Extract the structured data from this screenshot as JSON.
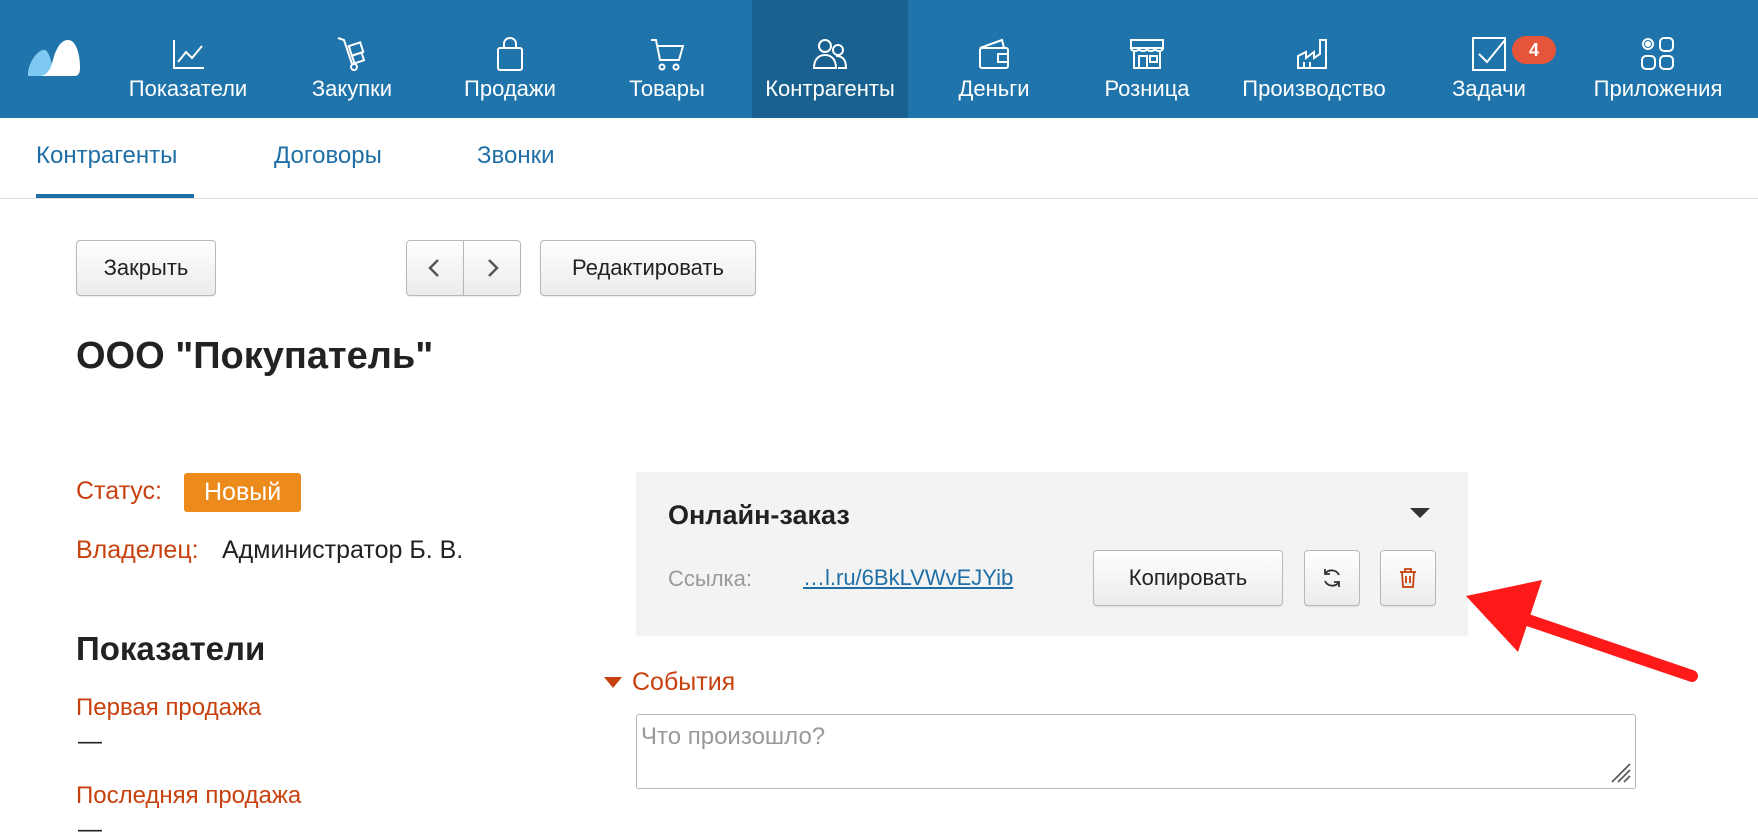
{
  "nav": {
    "items": [
      {
        "label": "Показатели",
        "icon": "chart-line-icon"
      },
      {
        "label": "Закупки",
        "icon": "hand-truck-icon"
      },
      {
        "label": "Продажи",
        "icon": "shopping-bag-icon"
      },
      {
        "label": "Товары",
        "icon": "cart-icon"
      },
      {
        "label": "Контрагенты",
        "icon": "people-icon"
      },
      {
        "label": "Деньги",
        "icon": "wallet-icon"
      },
      {
        "label": "Розница",
        "icon": "store-icon"
      },
      {
        "label": "Производство",
        "icon": "factory-icon"
      },
      {
        "label": "Задачи",
        "icon": "task-check-icon",
        "badge": "4"
      },
      {
        "label": "Приложения",
        "icon": "apps-icon"
      }
    ],
    "active": "Контрагенты"
  },
  "subtabs": {
    "items": [
      "Контрагенты",
      "Договоры",
      "Звонки"
    ],
    "active": "Контрагенты"
  },
  "toolbar": {
    "close_label": "Закрыть",
    "edit_label": "Редактировать"
  },
  "page": {
    "title": "ООО \"Покупатель\""
  },
  "details": {
    "status_label": "Статус:",
    "status_value": "Новый",
    "owner_label": "Владелец:",
    "owner_value": "Администратор Б. В."
  },
  "metrics": {
    "title": "Показатели",
    "first_sale_label": "Первая продажа",
    "first_sale_value": "—",
    "last_sale_label": "Последняя продажа",
    "last_sale_value": "—"
  },
  "online_order": {
    "title": "Онлайн-заказ",
    "link_label": "Ссылка:",
    "link_value": "…l.ru/6BkLVWvEJYib",
    "copy_label": "Копировать"
  },
  "events": {
    "label": "События",
    "placeholder": "Что произошло?"
  },
  "colors": {
    "nav_bg": "#1f74ab",
    "nav_active_bg": "#19628f",
    "accent_red": "#c7410f",
    "status_orange": "#ec8a1c",
    "link_blue": "#1f6fa6",
    "annotation_arrow": "#ff0000"
  }
}
